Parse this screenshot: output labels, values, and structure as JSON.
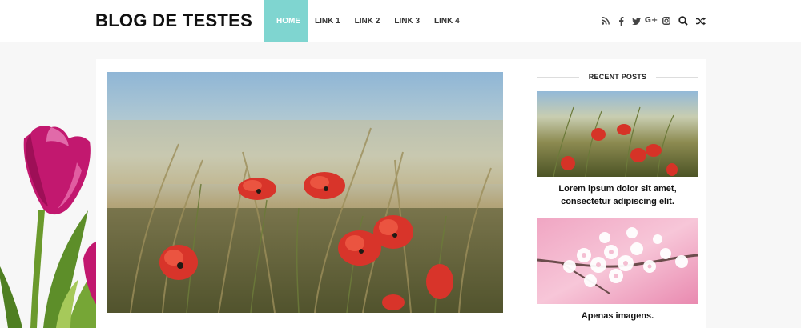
{
  "header": {
    "site_title": "BLOG DE TESTES",
    "nav": [
      "HOME",
      "LINK 1",
      "LINK 2",
      "LINK 3",
      "LINK 4"
    ],
    "active_nav": "HOME",
    "social_icons": [
      "rss-icon",
      "facebook-icon",
      "twitter-icon",
      "google-plus-icon",
      "instagram-icon"
    ],
    "google_plus_glyph": "G+",
    "tools": [
      "search-icon",
      "shuffle-icon"
    ]
  },
  "sidebar": {
    "widget_title": "RECENT POSTS",
    "posts": [
      {
        "title": "Lorem ipsum dolor sit amet, consectetur adipiscing elit.",
        "image": "poppy-field-thumbnail"
      },
      {
        "title": "Apenas imagens.",
        "image": "cherry-blossom-thumbnail"
      }
    ]
  },
  "colors": {
    "accent": "#7fd5d0",
    "tulip": "#c2186f",
    "leaf": "#5f8e2a"
  }
}
